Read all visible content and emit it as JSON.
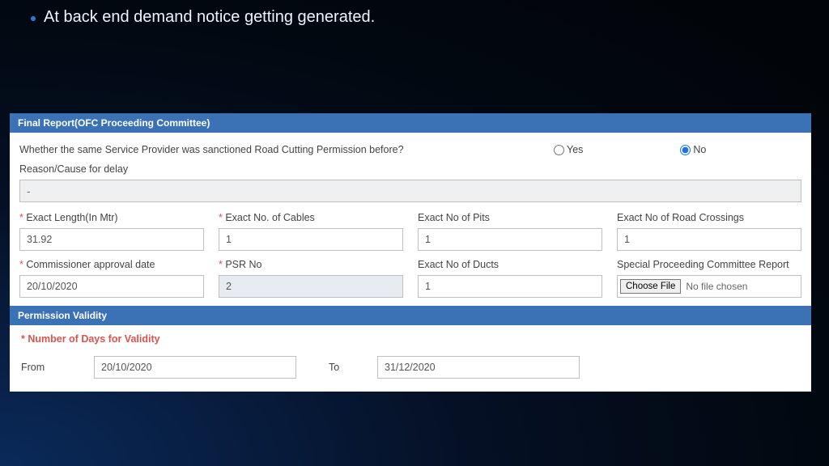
{
  "bullet_text": "At back end demand notice getting generated.",
  "section1": {
    "header": "Final Report(OFC Proceeding Committee)",
    "question": "Whether the same Service Provider was sanctioned Road Cutting Permission before?",
    "yes": "Yes",
    "no": "No",
    "delay_label": "Reason/Cause for delay",
    "delay_value": "-",
    "fields": [
      {
        "label": "Exact Length(In Mtr)",
        "value": "31.92",
        "required": true
      },
      {
        "label": "Exact No. of Cables",
        "value": "1",
        "required": true
      },
      {
        "label": "Exact No of Pits",
        "value": "1",
        "required": false
      },
      {
        "label": "Exact No of Road Crossings",
        "value": "1",
        "required": false
      },
      {
        "label": "Commissioner approval date",
        "value": "20/10/2020",
        "required": true
      },
      {
        "label": "PSR No",
        "value": "2",
        "required": true,
        "disabled": true
      },
      {
        "label": "Exact No of Ducts",
        "value": "1",
        "required": false
      },
      {
        "label": "Special Proceeding Committee Report",
        "file": true,
        "btn": "Choose File",
        "placeholder": "No file chosen"
      }
    ]
  },
  "section2": {
    "header": "Permission Validity",
    "title": "Number of Days for Validity",
    "from_label": "From",
    "from_value": "20/10/2020",
    "to_label": "To",
    "to_value": "31/12/2020"
  }
}
